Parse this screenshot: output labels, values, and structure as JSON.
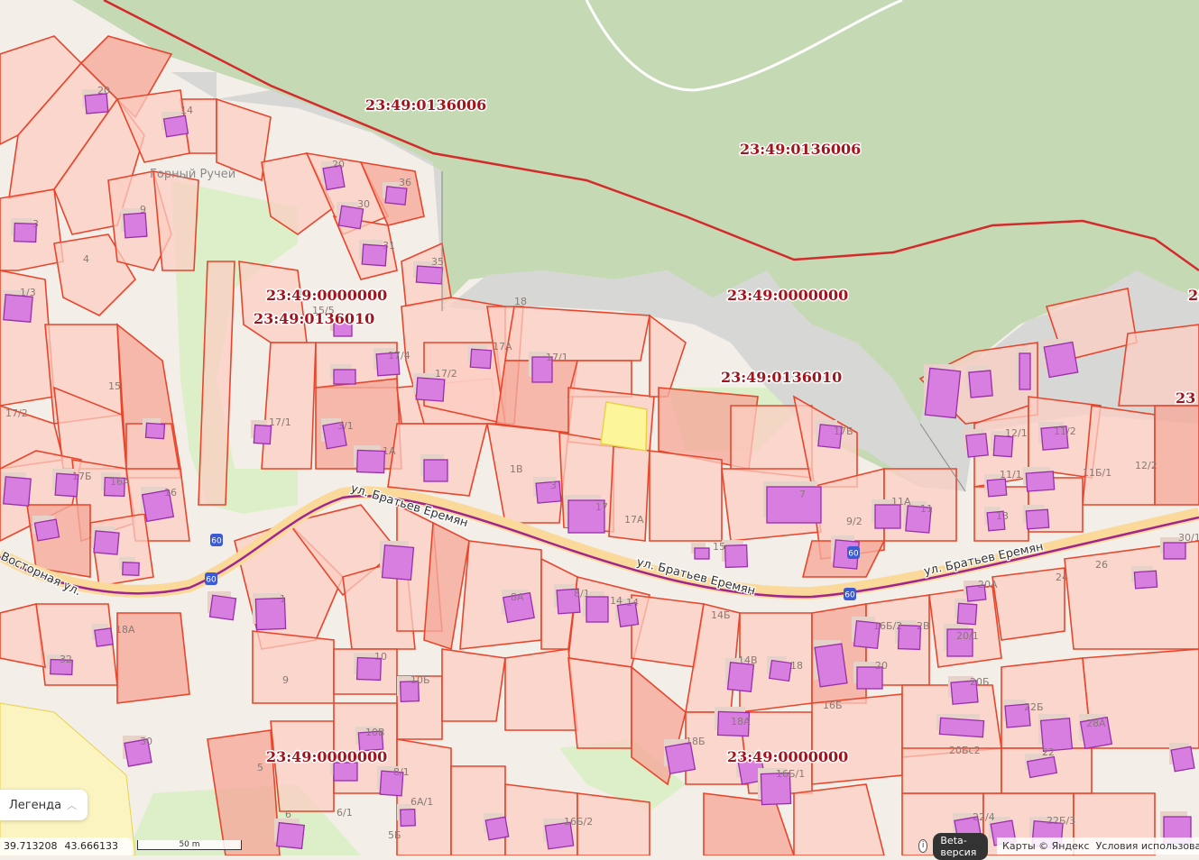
{
  "map": {
    "cadastral_labels": [
      "23:49:0136006",
      "23:49:0136006",
      "23:49:0000000",
      "23:49:0136010",
      "23:49:0000000",
      "23:49:0136010",
      "23:49:0000000",
      "23:49:0000000",
      "23",
      "23"
    ],
    "streets": [
      "ул. Братьев Еремян",
      "ул. Братьев Еремян",
      "ул. Братьев Еремян",
      "Восторная ул."
    ],
    "places": [
      "Горный Ручей"
    ],
    "house_numbers": [
      "20",
      "14",
      "20",
      "36",
      "30",
      "31",
      "35",
      "9",
      "3",
      "4",
      "1/3",
      "15/5",
      "15",
      "17/2",
      "17А",
      "17Б",
      "16А",
      "16",
      "18",
      "17/4",
      "17/1",
      "17/2",
      "17/1",
      "3/1",
      "1А",
      "1В",
      "3",
      "17",
      "17А",
      "17Б",
      "7",
      "9/2",
      "11А",
      "11",
      "11/1",
      "11/2",
      "12/1",
      "11Б/1",
      "12/2",
      "13",
      "15",
      "1",
      "9",
      "10",
      "10Б",
      "10В",
      "8/1",
      "6А/1",
      "6",
      "6/1",
      "5Б",
      "5",
      "8А",
      "8/1",
      "14",
      "14",
      "14Б",
      "14В",
      "18",
      "16Б",
      "18А",
      "18Б",
      "16Б/1",
      "16Б/2",
      "16Б/2",
      "2В",
      "20",
      "20А",
      "20/1",
      "20Б",
      "20Бс2",
      "22Б",
      "22",
      "28А",
      "22/4",
      "22Б/3",
      "24",
      "26",
      "30/1",
      "30",
      "32",
      "18А"
    ],
    "badges": [
      "60",
      "60",
      "60",
      "60"
    ]
  },
  "colors": {
    "forest": "#c5d9b4",
    "park": "#dcefc8",
    "parcel": "#fccdc3",
    "parcel_border": "#e8452b",
    "building": "#d77ee0",
    "boundary": "#d42a2a",
    "road": "#a1258f",
    "gray_zone": "#d7d7d5"
  },
  "legend": {
    "label": "Легенда",
    "icon": "chevron-up-icon"
  },
  "coords": {
    "lon": "39.713208",
    "lat": "43.666133"
  },
  "scale": {
    "label": "50 m"
  },
  "attribution": {
    "info_icon": "info-icon",
    "beta": "Beta-версия",
    "maps": "Карты © Яндекс",
    "terms": "Условия использования"
  }
}
